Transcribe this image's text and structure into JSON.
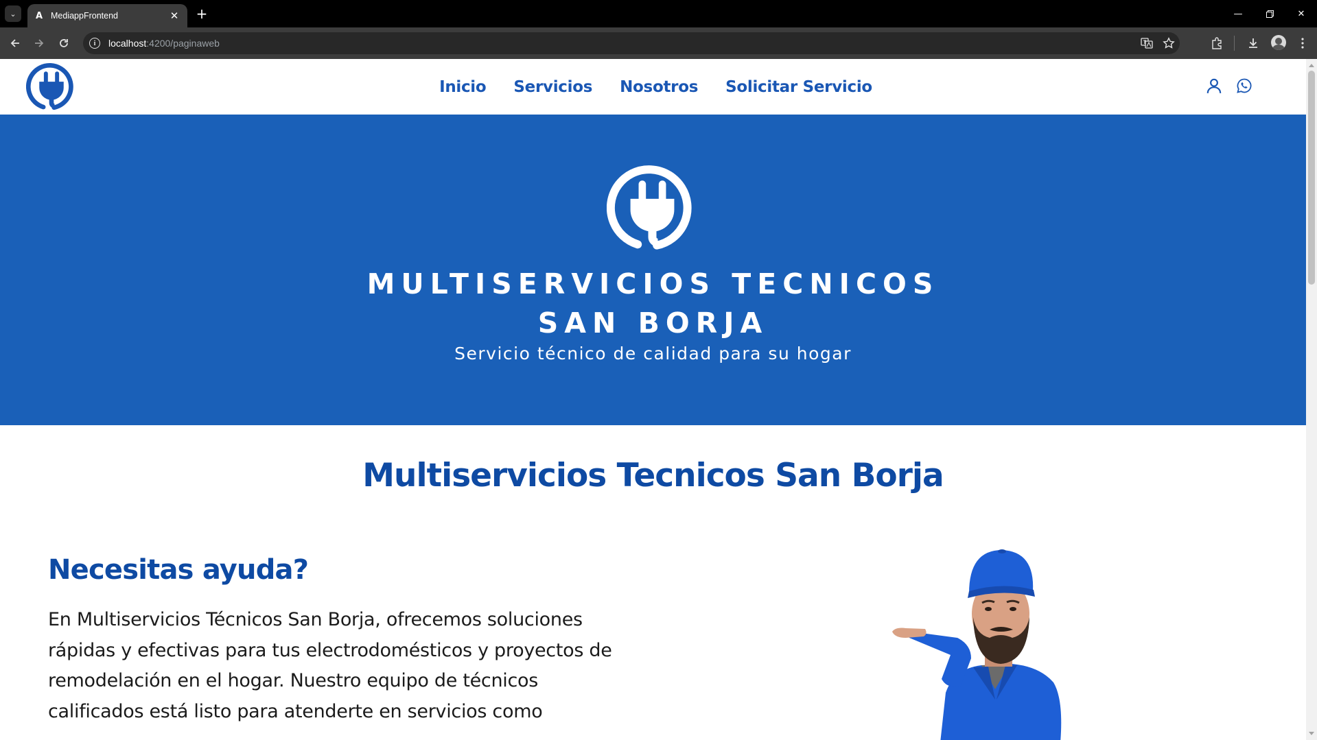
{
  "browser": {
    "tab_title": "MediappFrontend",
    "tab_favicon": "A",
    "url_host": "localhost",
    "url_path": ":4200/paginaweb",
    "icons": [
      "tab-list-icon",
      "close-icon",
      "new-tab-icon",
      "minimize-icon",
      "restore-icon",
      "window-close-icon",
      "back-icon",
      "forward-icon",
      "reload-icon",
      "site-info-icon",
      "translate-icon",
      "bookmark-star-icon",
      "extensions-icon",
      "download-icon",
      "profile-avatar",
      "more-menu-icon"
    ]
  },
  "nav": {
    "links": [
      {
        "label": "Inicio"
      },
      {
        "label": "Servicios"
      },
      {
        "label": "Nosotros"
      },
      {
        "label": "Solicitar Servicio"
      }
    ],
    "icons": [
      "plug-logo-icon",
      "user-icon",
      "whatsapp-icon"
    ]
  },
  "hero": {
    "title_line1": "MULTISERVICIOS TECNICOS",
    "title_line2": "SAN BORJA",
    "subtitle": "Servicio técnico de calidad para su hogar"
  },
  "content": {
    "section_title": "Multiservicios Tecnicos San Borja",
    "help_title": "Necesitas ayuda?",
    "help_lines": [
      "En Multiservicios Técnicos San Borja, ofrecemos soluciones",
      "rápidas y efectivas para tus electrodomésticos y proyectos de",
      "remodelación en el hogar. Nuestro equipo de técnicos",
      "calificados está listo para atenderte en servicios como"
    ]
  },
  "colors": {
    "brand_blue": "#1a60b8",
    "heading_blue": "#0e4aa3",
    "nav_blue": "#1a57b4"
  }
}
